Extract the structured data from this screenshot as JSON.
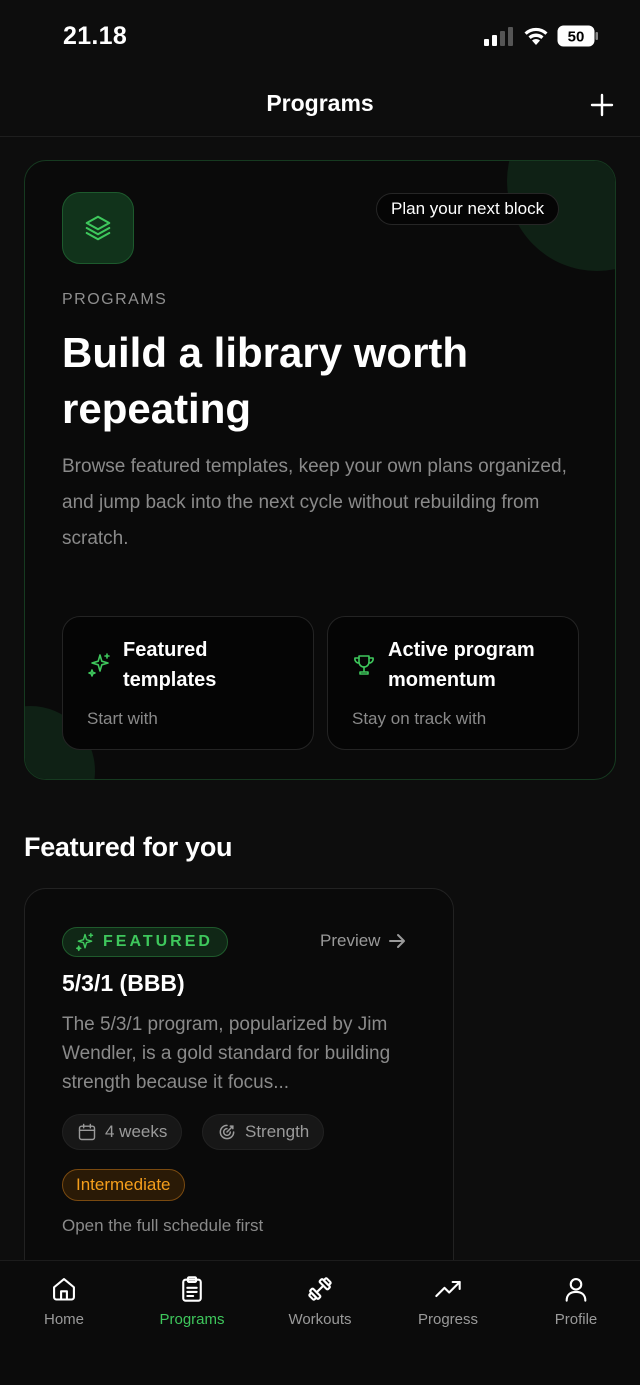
{
  "status_bar": {
    "time": "21.18",
    "battery": "50"
  },
  "header": {
    "title": "Programs"
  },
  "hero": {
    "pill": "Plan your next block",
    "eyebrow": "PROGRAMS",
    "title": "Build a library worth repeating",
    "description": "Browse featured templates, keep your own plans organized, and jump back into the next cycle without rebuilding from scratch.",
    "cards": [
      {
        "title": "Featured templates",
        "subtitle": "Start with",
        "icon": "sparkles-icon"
      },
      {
        "title": "Active program momentum",
        "subtitle": "Stay on track with",
        "icon": "trophy-icon"
      }
    ]
  },
  "featured_section": {
    "title": "Featured for you"
  },
  "program": {
    "badge": "FEATURED",
    "preview_label": "Preview",
    "name": "5/3/1 (BBB)",
    "description": "The 5/3/1 program, popularized by Jim Wendler, is a gold standard for building strength because it focus...",
    "duration": "4 weeks",
    "goal": "Strength",
    "level": "Intermediate",
    "footer": "Open the full schedule first"
  },
  "tabs": [
    {
      "label": "Home",
      "icon": "home-icon",
      "active": false
    },
    {
      "label": "Programs",
      "icon": "clipboard-icon",
      "active": true
    },
    {
      "label": "Workouts",
      "icon": "dumbbell-icon",
      "active": false
    },
    {
      "label": "Progress",
      "icon": "trending-up-icon",
      "active": false
    },
    {
      "label": "Profile",
      "icon": "user-icon",
      "active": false
    }
  ],
  "colors": {
    "accent": "#3ec75c",
    "intermediate": "#f59e1b",
    "background": "#0d0d0d"
  }
}
